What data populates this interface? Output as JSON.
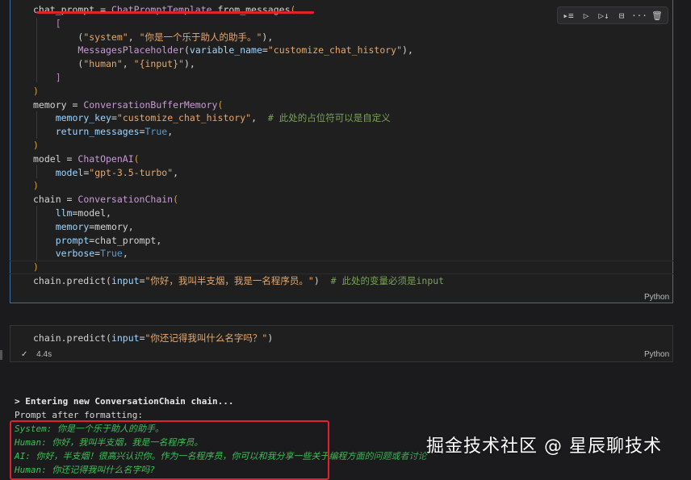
{
  "cell1": {
    "lines": [
      [
        [
          "tk-plain",
          "chat_prompt = "
        ],
        [
          "tk-func",
          "ChatPromptTemplate"
        ],
        [
          "tk-plain",
          "."
        ],
        [
          "tk-plain",
          "from_messages"
        ],
        [
          "tk-bracket1",
          "("
        ]
      ],
      [
        [
          "tk-plain",
          "    "
        ],
        [
          "tk-bracket2",
          "["
        ]
      ],
      [
        [
          "tk-plain",
          "        ("
        ],
        [
          "tk-str",
          "\"system\""
        ],
        [
          "tk-plain",
          ", "
        ],
        [
          "tk-str",
          "\"你是一个乐于助人的助手。\""
        ],
        [
          "tk-plain",
          "),"
        ]
      ],
      [
        [
          "tk-plain",
          "        "
        ],
        [
          "tk-func",
          "MessagesPlaceholder"
        ],
        [
          "tk-plain",
          "("
        ],
        [
          "tk-var",
          "variable_name"
        ],
        [
          "tk-plain",
          "="
        ],
        [
          "tk-str",
          "\"customize_chat_history\""
        ],
        [
          "tk-plain",
          "),"
        ]
      ],
      [
        [
          "tk-plain",
          "        ("
        ],
        [
          "tk-str",
          "\"human\""
        ],
        [
          "tk-plain",
          ", "
        ],
        [
          "tk-str",
          "\"{input}\""
        ],
        [
          "tk-plain",
          "),"
        ]
      ],
      [
        [
          "tk-plain",
          "    "
        ],
        [
          "tk-bracket2",
          "]"
        ]
      ],
      [
        [
          "tk-bracket1",
          ")"
        ]
      ],
      [
        [
          "tk-plain",
          "memory = "
        ],
        [
          "tk-func",
          "ConversationBufferMemory"
        ],
        [
          "tk-bracket1",
          "("
        ]
      ],
      [
        [
          "tk-plain",
          "    "
        ],
        [
          "tk-var",
          "memory_key"
        ],
        [
          "tk-plain",
          "="
        ],
        [
          "tk-str",
          "\"customize_chat_history\""
        ],
        [
          "tk-plain",
          ",  "
        ],
        [
          "tk-comment",
          "# 此处的占位符可以是自定义"
        ]
      ],
      [
        [
          "tk-plain",
          "    "
        ],
        [
          "tk-var",
          "return_messages"
        ],
        [
          "tk-plain",
          "="
        ],
        [
          "tk-kw",
          "True"
        ],
        [
          "tk-plain",
          ","
        ]
      ],
      [
        [
          "tk-bracket1",
          ")"
        ]
      ],
      [
        [
          "tk-plain",
          "model = "
        ],
        [
          "tk-func",
          "ChatOpenAI"
        ],
        [
          "tk-bracket1",
          "("
        ]
      ],
      [
        [
          "tk-plain",
          "    "
        ],
        [
          "tk-var",
          "model"
        ],
        [
          "tk-plain",
          "="
        ],
        [
          "tk-str",
          "\"gpt-3.5-turbo\""
        ],
        [
          "tk-plain",
          ","
        ]
      ],
      [
        [
          "tk-bracket1",
          ")"
        ]
      ],
      [
        [
          "tk-plain",
          "chain = "
        ],
        [
          "tk-func",
          "ConversationChain"
        ],
        [
          "tk-bracket1",
          "("
        ]
      ],
      [
        [
          "tk-plain",
          "    "
        ],
        [
          "tk-var",
          "llm"
        ],
        [
          "tk-plain",
          "=model,"
        ]
      ],
      [
        [
          "tk-plain",
          "    "
        ],
        [
          "tk-var",
          "memory"
        ],
        [
          "tk-plain",
          "=memory,"
        ]
      ],
      [
        [
          "tk-plain",
          "    "
        ],
        [
          "tk-var",
          "prompt"
        ],
        [
          "tk-plain",
          "=chat_prompt,"
        ]
      ],
      [
        [
          "tk-plain",
          "    "
        ],
        [
          "tk-var",
          "verbose"
        ],
        [
          "tk-plain",
          "="
        ],
        [
          "tk-kw",
          "True"
        ],
        [
          "tk-plain",
          ","
        ]
      ],
      [
        [
          "tk-bracket1",
          ")"
        ]
      ],
      [
        [
          "tk-plain",
          "chain.predict("
        ],
        [
          "tk-var",
          "input"
        ],
        [
          "tk-plain",
          "="
        ],
        [
          "tk-str",
          "\"你好，我叫半支烟，我是一名程序员。\""
        ],
        [
          "tk-plain",
          ")  "
        ],
        [
          "tk-comment",
          "# 此处的变量必须是input"
        ]
      ]
    ],
    "language": "Python"
  },
  "cell2": {
    "line": [
      [
        "tk-plain",
        "chain.predict("
      ],
      [
        "tk-var",
        "input"
      ],
      [
        "tk-plain",
        "="
      ],
      [
        "tk-str",
        "\"你还记得我叫什么名字吗？\""
      ],
      [
        "tk-plain",
        ")"
      ]
    ],
    "language": "Python",
    "check": "✓",
    "duration": "4.4s"
  },
  "output": {
    "line1": "> Entering new ConversationChain chain...",
    "line2": "Prompt after formatting:",
    "line3": "System: 你是一个乐于助人的助手。",
    "line4": "Human: 你好，我叫半支烟，我是一名程序员。",
    "line5": "AI: 你好，半支烟！很高兴认识你。作为一名程序员，你可以和我分享一些关于编程方面的问题或者讨论",
    "line6": "Human: 你还记得我叫什么名字吗?"
  },
  "toolbar_icons": [
    "run-by-line-icon",
    "execute-above-icon",
    "execute-below-icon",
    "split-cell-icon",
    "more-icon",
    "delete-icon"
  ],
  "watermark": "掘金技术社区 @ 星辰聊技术"
}
